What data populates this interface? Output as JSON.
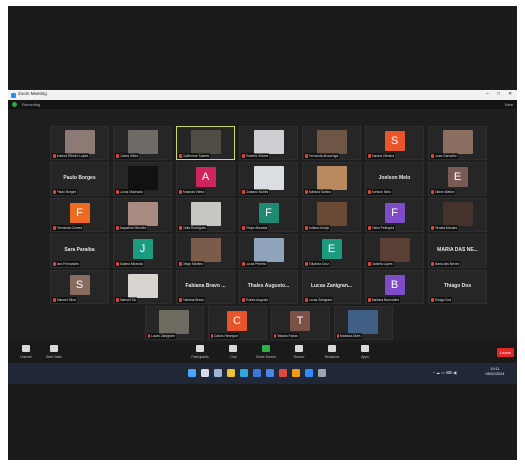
{
  "window": {
    "title": "Zoom Meeting",
    "controls": [
      "–",
      "□",
      "✕"
    ],
    "recording_label": "Recording",
    "view_label": "View"
  },
  "participants": [
    {
      "row": 0,
      "col": 1,
      "name": "Andrea Ribeiro Lopes",
      "kind": "photo",
      "color": "#8c7a74"
    },
    {
      "row": 0,
      "col": 2,
      "name": "Carlos Vieira",
      "kind": "photo",
      "color": "#6e6a66"
    },
    {
      "row": 0,
      "col": 3,
      "name": "Guilherme Soares",
      "kind": "photo",
      "color": "#4f4c43",
      "active": true
    },
    {
      "row": 0,
      "col": 4,
      "name": "Roberto Vianna",
      "kind": "photo",
      "color": "#cfcfd3"
    },
    {
      "row": 0,
      "col": 5,
      "name": "Fernanda Alvarenga",
      "kind": "photo",
      "color": "#6d5646"
    },
    {
      "row": 0,
      "col": 6,
      "name": "Sandra Oliveira",
      "kind": "letter",
      "letter": "S",
      "color": "#e8552a"
    },
    {
      "row": 0,
      "col": 7,
      "name": "Luiza Carvalho",
      "kind": "photo",
      "color": "#8a6e60"
    },
    {
      "row": 1,
      "col": 1,
      "name": "Paulo Borges",
      "kind": "text",
      "bigname": "Paulo Borges"
    },
    {
      "row": 1,
      "col": 2,
      "name": "Lucas Machado",
      "kind": "logo",
      "color": "#111"
    },
    {
      "row": 1,
      "col": 3,
      "name": "Amanda Vieira",
      "kind": "letter",
      "letter": "A",
      "color": "#d0245f"
    },
    {
      "row": 1,
      "col": 4,
      "name": "Gustavo Nunes",
      "kind": "photo",
      "color": "#dadde2"
    },
    {
      "row": 1,
      "col": 5,
      "name": "Adriana Santos",
      "kind": "photo",
      "color": "#b88a5e"
    },
    {
      "row": 1,
      "col": 6,
      "name": "Joelson Melo",
      "kind": "text",
      "bigname": "Joelson Melo"
    },
    {
      "row": 1,
      "col": 7,
      "name": "Elaine Mattos",
      "kind": "letter",
      "letter": "E",
      "color": "#7a5a55"
    },
    {
      "row": 2,
      "col": 1,
      "name": "Fernanda Gomes",
      "kind": "letter",
      "letter": "F",
      "color": "#ef6a21"
    },
    {
      "row": 2,
      "col": 2,
      "name": "Jaqueline Mendes",
      "kind": "photo",
      "color": "#a98b82"
    },
    {
      "row": 2,
      "col": 3,
      "name": "Célia Rodrigues",
      "kind": "photo",
      "color": "#c8c6c2"
    },
    {
      "row": 2,
      "col": 4,
      "name": "Felipe Almeida",
      "kind": "letter",
      "letter": "F",
      "color": "#1f8a72"
    },
    {
      "row": 2,
      "col": 5,
      "name": "Juliana Araújo",
      "kind": "photo",
      "color": "#6b4a35"
    },
    {
      "row": 2,
      "col": 6,
      "name": "Fabio Pellegrini",
      "kind": "letter",
      "letter": "F",
      "color": "#7f4cc7"
    },
    {
      "row": 2,
      "col": 7,
      "name": "Renata Moraes",
      "kind": "photo",
      "color": "#46322c"
    },
    {
      "row": 3,
      "col": 1,
      "name": "Iara Fernandes",
      "kind": "text",
      "bigname": "Sara Paraíba"
    },
    {
      "row": 3,
      "col": 2,
      "name": "Juliana Miranda",
      "kind": "letter",
      "letter": "J",
      "color": "#1a9b82"
    },
    {
      "row": 3,
      "col": 3,
      "name": "Diego Martins",
      "kind": "photo",
      "color": "#7b5b49"
    },
    {
      "row": 3,
      "col": 4,
      "name": "Lucas Pereira",
      "kind": "photo",
      "color": "#8fa3bb"
    },
    {
      "row": 3,
      "col": 5,
      "name": "Eduarda Cruz",
      "kind": "letter",
      "letter": "E",
      "color": "#1e9a80"
    },
    {
      "row": 3,
      "col": 6,
      "name": "Daniela Lopes",
      "kind": "photo",
      "color": "#5a4034"
    },
    {
      "row": 3,
      "col": 7,
      "name": "Maria das Neves",
      "kind": "text",
      "bigname": "MARIA DAS NE..."
    },
    {
      "row": 4,
      "col": 1,
      "name": "Samuel Silva",
      "kind": "letter",
      "letter": "S",
      "color": "#8a6b60"
    },
    {
      "row": 4,
      "col": 2,
      "name": "Samuel Sá",
      "kind": "photo",
      "color": "#d9d4cf"
    },
    {
      "row": 4,
      "col": 3,
      "name": "Fabiana Bravo",
      "kind": "text",
      "bigname": "Fabiana Bravo ..."
    },
    {
      "row": 4,
      "col": 4,
      "name": "Thales Augusto",
      "kind": "text",
      "bigname": "Thales Augusto..."
    },
    {
      "row": 4,
      "col": 5,
      "name": "Lucas Zanigram",
      "kind": "text",
      "bigname": "Lucas Zanigran..."
    },
    {
      "row": 4,
      "col": 6,
      "name": "Barbara Burnoldier",
      "kind": "letter",
      "letter": "B",
      "color": "#7f4cc7"
    },
    {
      "row": 4,
      "col": 7,
      "name": "Thiago Dos",
      "kind": "text",
      "bigname": "Thiago Dos"
    },
    {
      "row": 5,
      "col": 2.5,
      "name": "Lucas Zanigram",
      "kind": "photo",
      "color": "#6d6a60"
    },
    {
      "row": 5,
      "col": 3.5,
      "name": "Carlos Henrique",
      "kind": "letter",
      "letter": "C",
      "color": "#e8552a"
    },
    {
      "row": 5,
      "col": 4.5,
      "name": "Tatiana Farias",
      "kind": "letter",
      "letter": "T",
      "color": "#7b5146"
    },
    {
      "row": 5,
      "col": 5.5,
      "name": "Mariana Alves",
      "kind": "photo",
      "color": "#3f5f85"
    }
  ],
  "toolbar": {
    "left": [
      {
        "label": "Unmute",
        "color": "#d9d9d9"
      },
      {
        "label": "Start Video",
        "color": "#d9d9d9"
      }
    ],
    "center": [
      {
        "label": "Participants",
        "color": "#d9d9d9"
      },
      {
        "label": "Chat",
        "color": "#d9d9d9"
      },
      {
        "label": "Share Screen",
        "color": "#28b34a"
      },
      {
        "label": "Record",
        "color": "#d9d9d9"
      },
      {
        "label": "Reactions",
        "color": "#d9d9d9"
      },
      {
        "label": "Apps",
        "color": "#d9d9d9"
      }
    ],
    "leave_label": "Leave"
  },
  "taskbar": {
    "icons": [
      {
        "name": "start-icon",
        "color": "#4aa3ff"
      },
      {
        "name": "search-icon",
        "color": "#d6dce6"
      },
      {
        "name": "task-view-icon",
        "color": "#9fb3d6"
      },
      {
        "name": "files-icon",
        "color": "#f1c232"
      },
      {
        "name": "edge-icon",
        "color": "#2fa8e0"
      },
      {
        "name": "store-icon",
        "color": "#3c78d8"
      },
      {
        "name": "mail-icon",
        "color": "#4a86e8"
      },
      {
        "name": "chrome-icon",
        "color": "#e04b3c"
      },
      {
        "name": "firefox-icon",
        "color": "#f39c12"
      },
      {
        "name": "zoom-icon",
        "color": "#2d8cff"
      },
      {
        "name": "settings-icon",
        "color": "#9aa3b0"
      }
    ],
    "tray": "^ ☁ ▭ ⌨ ◀)",
    "time": "19:11",
    "date": "08/01/2024"
  }
}
